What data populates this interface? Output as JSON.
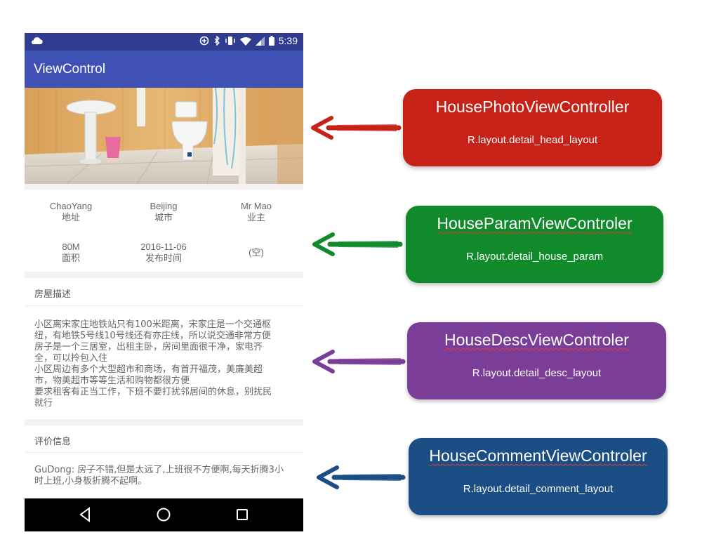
{
  "status_bar": {
    "time": "5:39"
  },
  "app_bar": {
    "title": "ViewControl"
  },
  "params": [
    {
      "value": "ChaoYang",
      "label": "地址"
    },
    {
      "value": "Beijing",
      "label": "城市"
    },
    {
      "value": "Mr Mao",
      "label": "业主"
    },
    {
      "value": "80M",
      "label": "面积"
    },
    {
      "value": "2016-11-06",
      "label": "发布时间"
    },
    {
      "value": "(空)",
      "label": ""
    }
  ],
  "description": {
    "title": "房屋描述",
    "text": "小区离宋家庄地铁站只有100米距离，宋家庄是一个交通枢\n纽，有地铁5号线10号线还有亦庄线，所以说交通非常方便\n房子是一个三居室，出租主卧，房间里面很干净，家电齐\n全，可以拎包入住\n小区周边有多个大型超市和商场，有首开福茂，美廉美超\n市，物美超市等等生活和购物都很方便\n要求租客有正当工作，下班不要打扰邻居间的休息，别扰民\n就行"
  },
  "comments": {
    "title": "评价信息",
    "text": "GuDong: 房子不错,但是太远了,上班很不方便啊,每天折腾3小时上班,小身板折腾不起啊。"
  },
  "callouts": [
    {
      "title": "HousePhotoViewController",
      "subtitle": "R.layout.detail_head_layout",
      "color": "#c62218"
    },
    {
      "title": "HouseParamViewControler",
      "subtitle": "R.layout.detail_house_param",
      "color": "#118a2c"
    },
    {
      "title": "HouseDescViewControler",
      "subtitle": "R.layout.detail_desc_layout",
      "color": "#7a3e99"
    },
    {
      "title": "HouseCommentViewControler",
      "subtitle": "R.layout.detail_comment_layout",
      "color": "#1a4e85"
    }
  ]
}
